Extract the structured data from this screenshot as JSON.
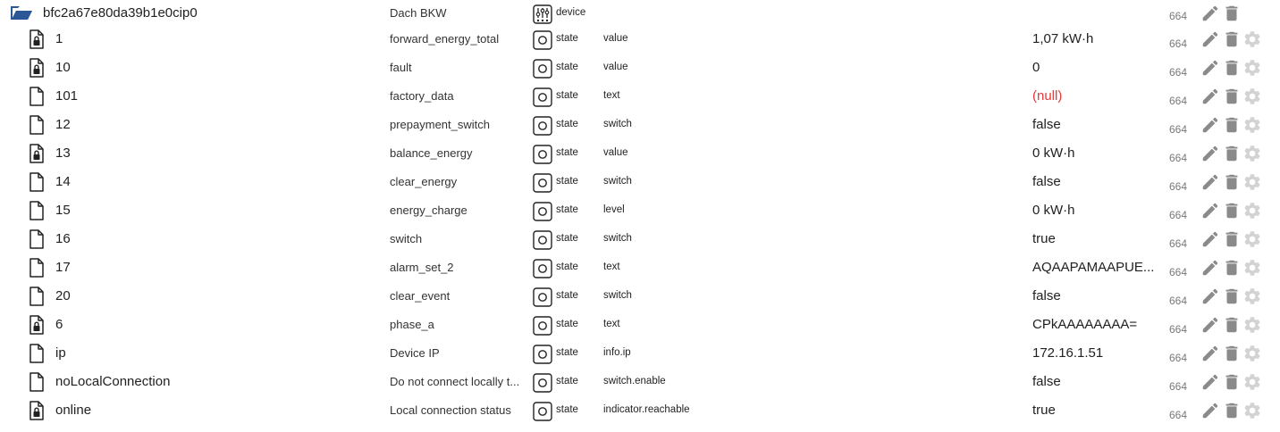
{
  "colors": {
    "text": "#212121",
    "null_value": "#e5393b",
    "icon_gray": "#8a8a8a",
    "folder_blue": "#2b5797",
    "cfg_gray": "#d3d3d3"
  },
  "parent": {
    "id": "bfc2a67e80da39b1e0cip0",
    "name": "Dach BKW",
    "type": "device",
    "type_icon": "device-icon",
    "acl": "664"
  },
  "rows": [
    {
      "id": "1",
      "name": "forward_energy_total",
      "type": "state",
      "role": "value",
      "value": "1,07 kW·h",
      "acl": "664",
      "locked": true,
      "is_null": false
    },
    {
      "id": "10",
      "name": "fault",
      "type": "state",
      "role": "value",
      "value": "0",
      "acl": "664",
      "locked": true,
      "is_null": false
    },
    {
      "id": "101",
      "name": "factory_data",
      "type": "state",
      "role": "text",
      "value": "(null)",
      "acl": "664",
      "locked": false,
      "is_null": true
    },
    {
      "id": "12",
      "name": "prepayment_switch",
      "type": "state",
      "role": "switch",
      "value": "false",
      "acl": "664",
      "locked": false,
      "is_null": false
    },
    {
      "id": "13",
      "name": "balance_energy",
      "type": "state",
      "role": "value",
      "value": "0 kW·h",
      "acl": "664",
      "locked": true,
      "is_null": false
    },
    {
      "id": "14",
      "name": "clear_energy",
      "type": "state",
      "role": "switch",
      "value": "false",
      "acl": "664",
      "locked": false,
      "is_null": false
    },
    {
      "id": "15",
      "name": "energy_charge",
      "type": "state",
      "role": "level",
      "value": "0 kW·h",
      "acl": "664",
      "locked": false,
      "is_null": false
    },
    {
      "id": "16",
      "name": "switch",
      "type": "state",
      "role": "switch",
      "value": "true",
      "acl": "664",
      "locked": false,
      "is_null": false
    },
    {
      "id": "17",
      "name": "alarm_set_2",
      "type": "state",
      "role": "text",
      "value": "AQAAPAMAAPUE...",
      "acl": "664",
      "locked": false,
      "is_null": false
    },
    {
      "id": "20",
      "name": "clear_event",
      "type": "state",
      "role": "switch",
      "value": "false",
      "acl": "664",
      "locked": false,
      "is_null": false
    },
    {
      "id": "6",
      "name": "phase_a",
      "type": "state",
      "role": "text",
      "value": "CPkAAAAAAAA=",
      "acl": "664",
      "locked": true,
      "is_null": false
    },
    {
      "id": "ip",
      "name": "Device IP",
      "type": "state",
      "role": "info.ip",
      "value": "172.16.1.51",
      "acl": "664",
      "locked": false,
      "is_null": false
    },
    {
      "id": "noLocalConnection",
      "name": "Do not connect locally t...",
      "type": "state",
      "role": "switch.enable",
      "value": "false",
      "acl": "664",
      "locked": false,
      "is_null": false
    },
    {
      "id": "online",
      "name": "Local connection status",
      "type": "state",
      "role": "indicator.reachable",
      "value": "true",
      "acl": "664",
      "locked": true,
      "is_null": false
    }
  ]
}
